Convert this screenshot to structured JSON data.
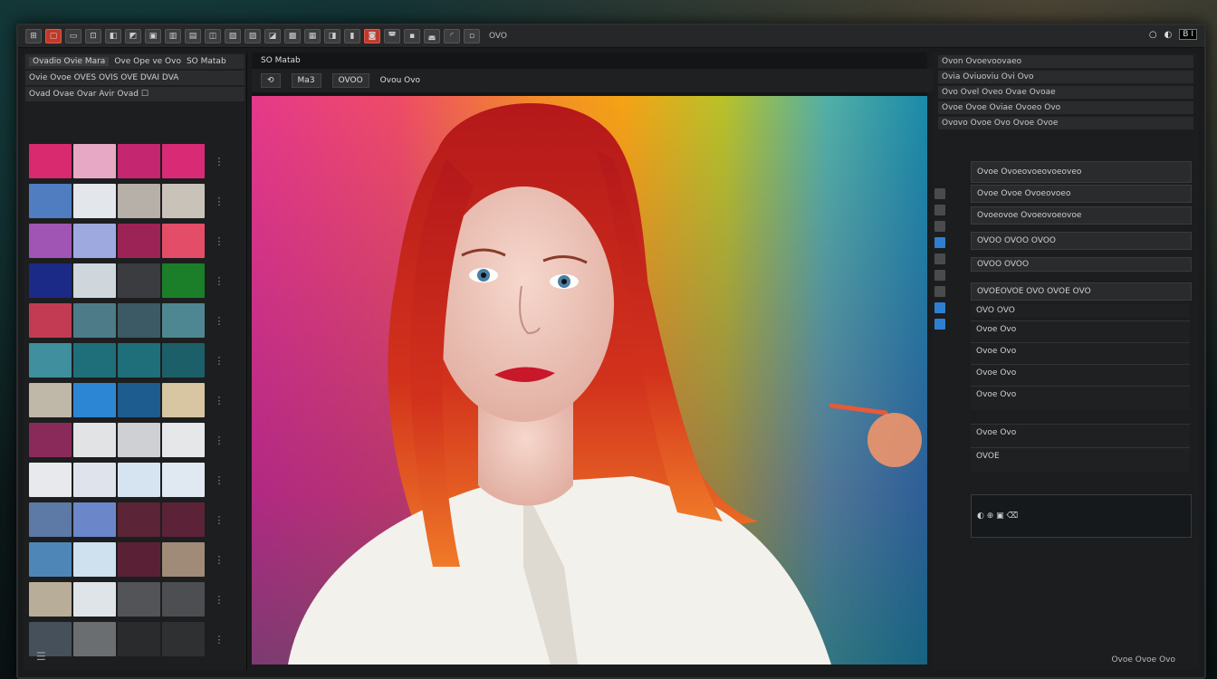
{
  "toolbar": {
    "button_labels": [
      "⊞",
      "▢",
      "▭",
      "⊡",
      "◧",
      "◩",
      "▣",
      "▥",
      "▤",
      "◫",
      "▧",
      "▨",
      "◪",
      "▩",
      "▦",
      "◨",
      "▮",
      "◙",
      "◚",
      "▪",
      "◛",
      "◜",
      "▫"
    ],
    "label_a": "OVO",
    "right_a": "○",
    "right_b": "◐",
    "right_boxed": "B I"
  },
  "left_panel": {
    "tab_a": "Ovadio Ovie Mara",
    "tab_b": "Ove Ope ve Ovo",
    "tab_c": "SO Matab",
    "row2": "Ovie Ovoe OVES OVIS OVE DVAI DVA",
    "row3": "Ovad Ovae Ovar Avir Ovad ☐"
  },
  "swatches": [
    [
      "#d9296f",
      "#e7a8c5",
      "#c42670",
      "#d92a76"
    ],
    [
      "#4f7dc0",
      "#e3e6ea",
      "#b7b0a8",
      "#c9c2b9"
    ],
    [
      "#a055b5",
      "#9ea9e0",
      "#9c2356",
      "#e44d68"
    ],
    [
      "#1b2a86",
      "#cfd7dd",
      "#3a3c40",
      "#1b7f2a"
    ],
    [
      "#c23b52",
      "#4d7c88",
      "#3c5a65",
      "#4e8791"
    ],
    [
      "#3f8f9e",
      "#1f6f7a",
      "#1f6f7a",
      "#1d5f68"
    ],
    [
      "#bfb7a8",
      "#2d86d4",
      "#1c5c8f",
      "#d8c6a2"
    ],
    [
      "#8a2a5a",
      "#e2e3e5",
      "#cfd0d3",
      "#e6e7e9"
    ],
    [
      "#e8e9ec",
      "#dfe4ec",
      "#d6e4f2",
      "#e0e8f2"
    ],
    [
      "#5d79a6",
      "#6c87c9",
      "#5b2437",
      "#5c2338"
    ],
    [
      "#4f86b8",
      "#cfe0ee",
      "#5a2136",
      "#a08a78"
    ],
    [
      "#b8ad98",
      "#dfe4e8",
      "#525457",
      "#4c4e51"
    ],
    [
      "#46505a",
      "#6a6e70",
      "#2a2b2d",
      "#2f3032"
    ]
  ],
  "canvas": {
    "tab_label": "SO Matab",
    "tool_a": "⟲",
    "tool_b": "Ma3",
    "tool_c": "OVOO",
    "tool_d": "Ovou Ovo"
  },
  "right_panel": {
    "header_a": "Ovon Ovoevoovaeo",
    "header_b": "Ovia Oviuoviu Ovi Ovo",
    "row_a": "Ovo Ovel Oveo Ovae Ovoae",
    "row_b": "Ovoe Ovoe Oviae Ovoeo Ovo",
    "row_c": "Ovovo Ovoe Ovo Ovoe Ovoe",
    "sec_a": "Ovoe Ovoeovoeovoeoveo",
    "sec_b": "Ovoe Ovoe Ovoeovoeo",
    "sec_c": "Ovoeovoe Ovoeovoeovoe",
    "sec_d": "OVOO OVOO OVOO",
    "sec_e": "OVOO OVOO",
    "sec_f": "OVOEOVOE OVO OVOE OVO",
    "sec_g": "OVO OVO",
    "list_a": "Ovoe Ovo",
    "list_b": "Ovoe Ovo",
    "list_c": "Ovoe Ovo",
    "list_d": "Ovoe Ovo",
    "list_e": "Ovoe Ovo",
    "list_f": "OVOE",
    "status": "Ovoe Ovoe Ovo"
  }
}
